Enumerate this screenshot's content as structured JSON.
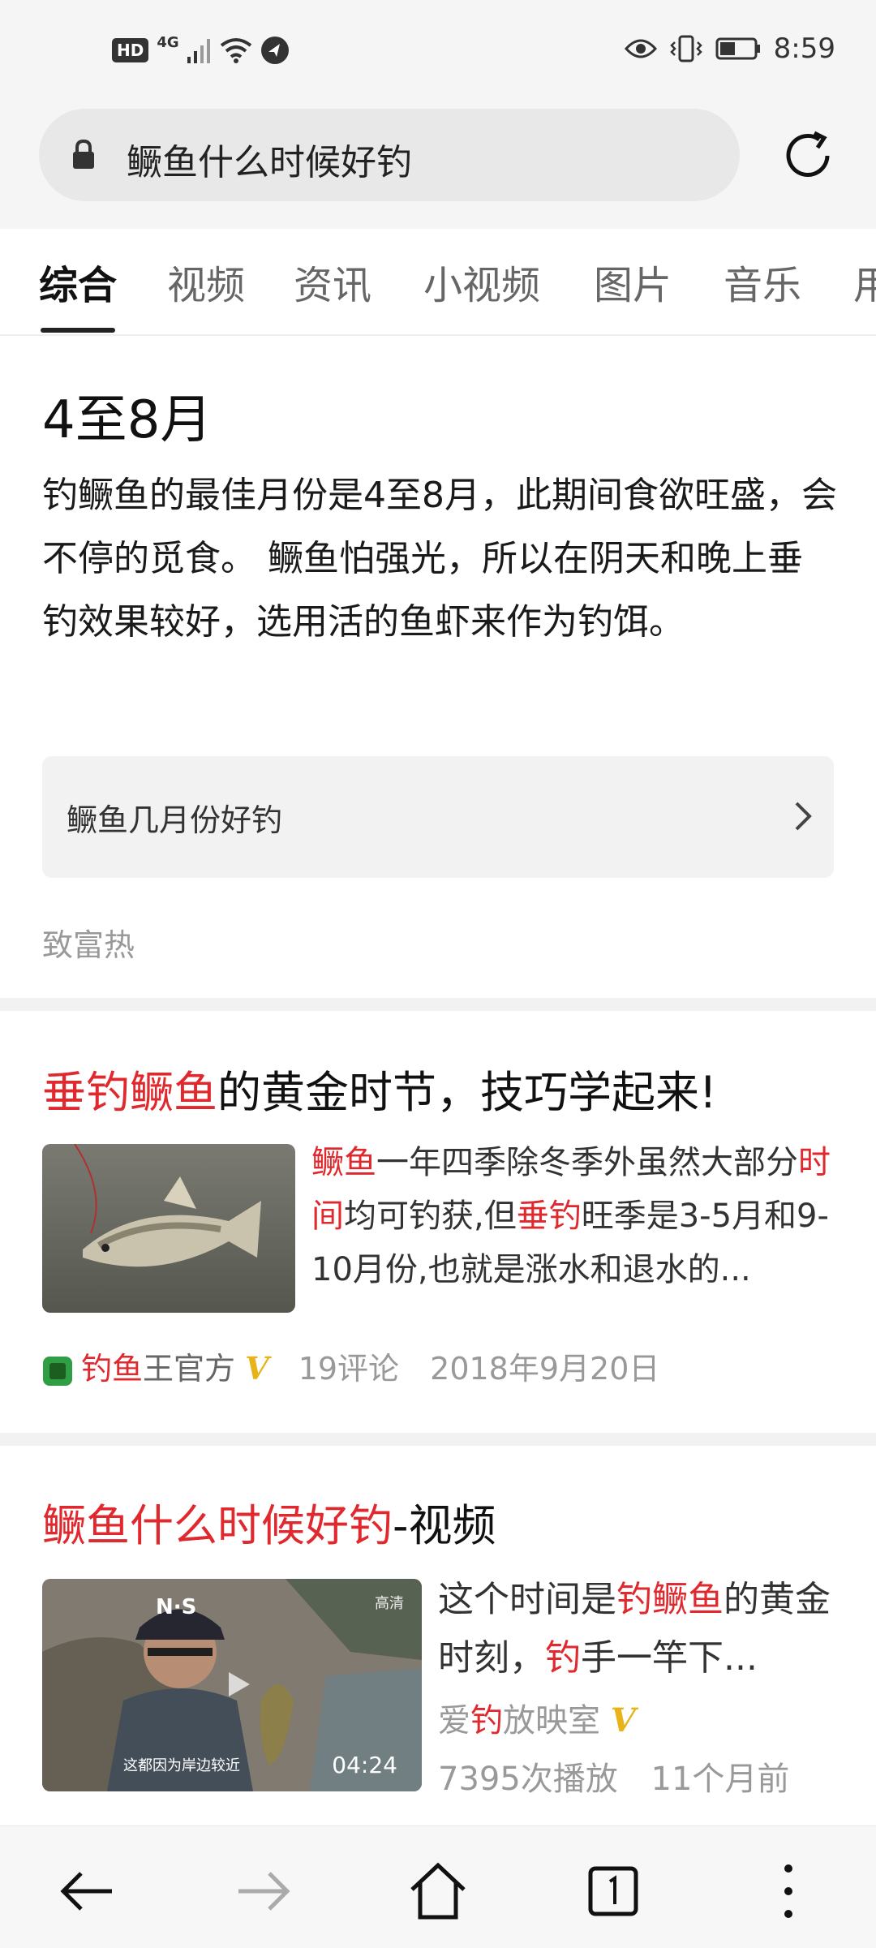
{
  "status": {
    "hd": "HD",
    "network": "4G",
    "time": "8:59"
  },
  "search": {
    "query": "鳜鱼什么时候好钓"
  },
  "tabs": [
    "综合",
    "视频",
    "资讯",
    "小视频",
    "图片",
    "音乐",
    "用"
  ],
  "answer": {
    "title": "4至8月",
    "body": "钓鳜鱼的最佳月份是4至8月，此期间食欲旺盛，会不停的觅食。 鳜鱼怕强光，所以在阴天和晚上垂钓效果较好，选用活的鱼虾来作为钓饵。",
    "related_query": "鳜鱼几月份好钓",
    "source": "致富热"
  },
  "result1": {
    "title_hl": "垂钓鳜鱼",
    "title_rest": "的黄金时节，技巧学起来!",
    "snippet_hl1": "鳜鱼",
    "snippet_p1": "一年四季除冬季外虽然大部分",
    "snippet_hl2": "时间",
    "snippet_p2": "均可钓获,但",
    "snippet_hl3": "垂钓",
    "snippet_p3": "旺季是3-5月和9-10月份,也就是涨水和退水的...",
    "author_hl": "钓鱼",
    "author_rest": "王官方",
    "verified": "V",
    "comments": "19评论",
    "date": "2018年9月20日"
  },
  "result2": {
    "title_hl": "鳜鱼什么时候好钓",
    "title_rest": "-视频",
    "snippet_p1": "这个时间是",
    "snippet_hl1": "钓鳜鱼",
    "snippet_p2": "的黄金时刻，",
    "snippet_hl2": "钓",
    "snippet_p3": "手一竿下...",
    "author_p1": "爱",
    "author_hl": "钓",
    "author_p2": "放映室",
    "verified": "V",
    "duration": "04:24",
    "quality": "高清",
    "cap_text": "N·S",
    "caption": "这都因为岸边较近",
    "plays": "7395次播放",
    "age": "11个月前"
  },
  "colors": {
    "highlight": "#e0292e",
    "verified": "#e7b319"
  }
}
